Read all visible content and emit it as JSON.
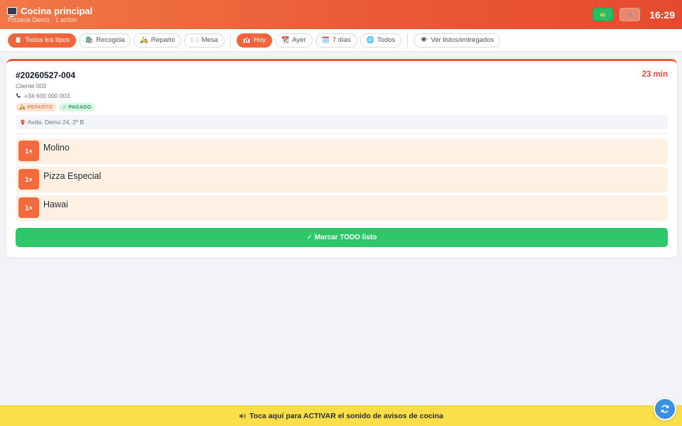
{
  "header": {
    "title": "Cocina principal",
    "subtitle": "Pizzeria Demo · 1 activo",
    "time": "16:29",
    "icons": {
      "tv": "tv-icon",
      "sound": "speaker-icon",
      "settings": "gear-icon"
    },
    "colors": {
      "bar": "#ea5a36",
      "sound_button": "#2dbb62",
      "settings_button": "#e9876c"
    }
  },
  "filters": {
    "types": [
      {
        "label": "Todos los tipos",
        "icon": "📋",
        "active": true
      },
      {
        "label": "Recogida",
        "icon": "🛍️",
        "active": false
      },
      {
        "label": "Reparto",
        "icon": "🛵",
        "active": false
      },
      {
        "label": "Mesa",
        "icon": "🍽️",
        "active": false
      }
    ],
    "dates": [
      {
        "label": "Hoy",
        "icon": "📅",
        "active": true
      },
      {
        "label": "Ayer",
        "icon": "📆",
        "active": false
      },
      {
        "label": "7 días",
        "icon": "🗓️",
        "active": false
      },
      {
        "label": "Todos",
        "icon": "🌐",
        "active": false
      }
    ],
    "view_toggle": {
      "label": "Ver listos/entregados",
      "icon": "👁️"
    },
    "active_color": "#f0653a"
  },
  "order": {
    "id": "#20260527-004",
    "elapsed": "23 min",
    "customer": "Cliente 003",
    "phone": "+34 600 000 003",
    "badges": {
      "delivery": "🛵 REPARTO",
      "paid": "✓ PAGADO"
    },
    "address": "Avda. Demo 24, 2º B",
    "items": [
      {
        "qty": "1×",
        "name": "Molino"
      },
      {
        "qty": "1×",
        "name": "Pizza Especial"
      },
      {
        "qty": "1×",
        "name": "Hawai"
      }
    ],
    "mark_all_label": "✓ Marcar TODO listo",
    "mark_all_color": "#2ec76a"
  },
  "banner": {
    "text": "Toca aquí para ACTIVAR el sonido de avisos de cocina",
    "icon": "speaker-icon",
    "color": "#fbdf4a"
  },
  "fab": {
    "icon": "refresh-icon"
  }
}
